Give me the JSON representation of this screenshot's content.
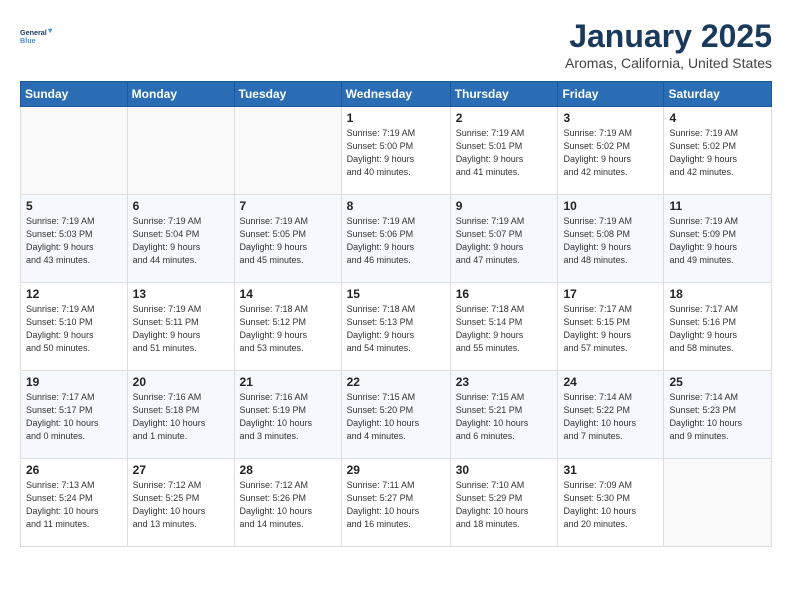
{
  "logo": {
    "line1": "General",
    "line2": "Blue"
  },
  "title": "January 2025",
  "subtitle": "Aromas, California, United States",
  "days_header": [
    "Sunday",
    "Monday",
    "Tuesday",
    "Wednesday",
    "Thursday",
    "Friday",
    "Saturday"
  ],
  "weeks": [
    [
      {
        "day": "",
        "info": ""
      },
      {
        "day": "",
        "info": ""
      },
      {
        "day": "",
        "info": ""
      },
      {
        "day": "1",
        "info": "Sunrise: 7:19 AM\nSunset: 5:00 PM\nDaylight: 9 hours\nand 40 minutes."
      },
      {
        "day": "2",
        "info": "Sunrise: 7:19 AM\nSunset: 5:01 PM\nDaylight: 9 hours\nand 41 minutes."
      },
      {
        "day": "3",
        "info": "Sunrise: 7:19 AM\nSunset: 5:02 PM\nDaylight: 9 hours\nand 42 minutes."
      },
      {
        "day": "4",
        "info": "Sunrise: 7:19 AM\nSunset: 5:02 PM\nDaylight: 9 hours\nand 42 minutes."
      }
    ],
    [
      {
        "day": "5",
        "info": "Sunrise: 7:19 AM\nSunset: 5:03 PM\nDaylight: 9 hours\nand 43 minutes."
      },
      {
        "day": "6",
        "info": "Sunrise: 7:19 AM\nSunset: 5:04 PM\nDaylight: 9 hours\nand 44 minutes."
      },
      {
        "day": "7",
        "info": "Sunrise: 7:19 AM\nSunset: 5:05 PM\nDaylight: 9 hours\nand 45 minutes."
      },
      {
        "day": "8",
        "info": "Sunrise: 7:19 AM\nSunset: 5:06 PM\nDaylight: 9 hours\nand 46 minutes."
      },
      {
        "day": "9",
        "info": "Sunrise: 7:19 AM\nSunset: 5:07 PM\nDaylight: 9 hours\nand 47 minutes."
      },
      {
        "day": "10",
        "info": "Sunrise: 7:19 AM\nSunset: 5:08 PM\nDaylight: 9 hours\nand 48 minutes."
      },
      {
        "day": "11",
        "info": "Sunrise: 7:19 AM\nSunset: 5:09 PM\nDaylight: 9 hours\nand 49 minutes."
      }
    ],
    [
      {
        "day": "12",
        "info": "Sunrise: 7:19 AM\nSunset: 5:10 PM\nDaylight: 9 hours\nand 50 minutes."
      },
      {
        "day": "13",
        "info": "Sunrise: 7:19 AM\nSunset: 5:11 PM\nDaylight: 9 hours\nand 51 minutes."
      },
      {
        "day": "14",
        "info": "Sunrise: 7:18 AM\nSunset: 5:12 PM\nDaylight: 9 hours\nand 53 minutes."
      },
      {
        "day": "15",
        "info": "Sunrise: 7:18 AM\nSunset: 5:13 PM\nDaylight: 9 hours\nand 54 minutes."
      },
      {
        "day": "16",
        "info": "Sunrise: 7:18 AM\nSunset: 5:14 PM\nDaylight: 9 hours\nand 55 minutes."
      },
      {
        "day": "17",
        "info": "Sunrise: 7:17 AM\nSunset: 5:15 PM\nDaylight: 9 hours\nand 57 minutes."
      },
      {
        "day": "18",
        "info": "Sunrise: 7:17 AM\nSunset: 5:16 PM\nDaylight: 9 hours\nand 58 minutes."
      }
    ],
    [
      {
        "day": "19",
        "info": "Sunrise: 7:17 AM\nSunset: 5:17 PM\nDaylight: 10 hours\nand 0 minutes."
      },
      {
        "day": "20",
        "info": "Sunrise: 7:16 AM\nSunset: 5:18 PM\nDaylight: 10 hours\nand 1 minute."
      },
      {
        "day": "21",
        "info": "Sunrise: 7:16 AM\nSunset: 5:19 PM\nDaylight: 10 hours\nand 3 minutes."
      },
      {
        "day": "22",
        "info": "Sunrise: 7:15 AM\nSunset: 5:20 PM\nDaylight: 10 hours\nand 4 minutes."
      },
      {
        "day": "23",
        "info": "Sunrise: 7:15 AM\nSunset: 5:21 PM\nDaylight: 10 hours\nand 6 minutes."
      },
      {
        "day": "24",
        "info": "Sunrise: 7:14 AM\nSunset: 5:22 PM\nDaylight: 10 hours\nand 7 minutes."
      },
      {
        "day": "25",
        "info": "Sunrise: 7:14 AM\nSunset: 5:23 PM\nDaylight: 10 hours\nand 9 minutes."
      }
    ],
    [
      {
        "day": "26",
        "info": "Sunrise: 7:13 AM\nSunset: 5:24 PM\nDaylight: 10 hours\nand 11 minutes."
      },
      {
        "day": "27",
        "info": "Sunrise: 7:12 AM\nSunset: 5:25 PM\nDaylight: 10 hours\nand 13 minutes."
      },
      {
        "day": "28",
        "info": "Sunrise: 7:12 AM\nSunset: 5:26 PM\nDaylight: 10 hours\nand 14 minutes."
      },
      {
        "day": "29",
        "info": "Sunrise: 7:11 AM\nSunset: 5:27 PM\nDaylight: 10 hours\nand 16 minutes."
      },
      {
        "day": "30",
        "info": "Sunrise: 7:10 AM\nSunset: 5:29 PM\nDaylight: 10 hours\nand 18 minutes."
      },
      {
        "day": "31",
        "info": "Sunrise: 7:09 AM\nSunset: 5:30 PM\nDaylight: 10 hours\nand 20 minutes."
      },
      {
        "day": "",
        "info": ""
      }
    ]
  ]
}
